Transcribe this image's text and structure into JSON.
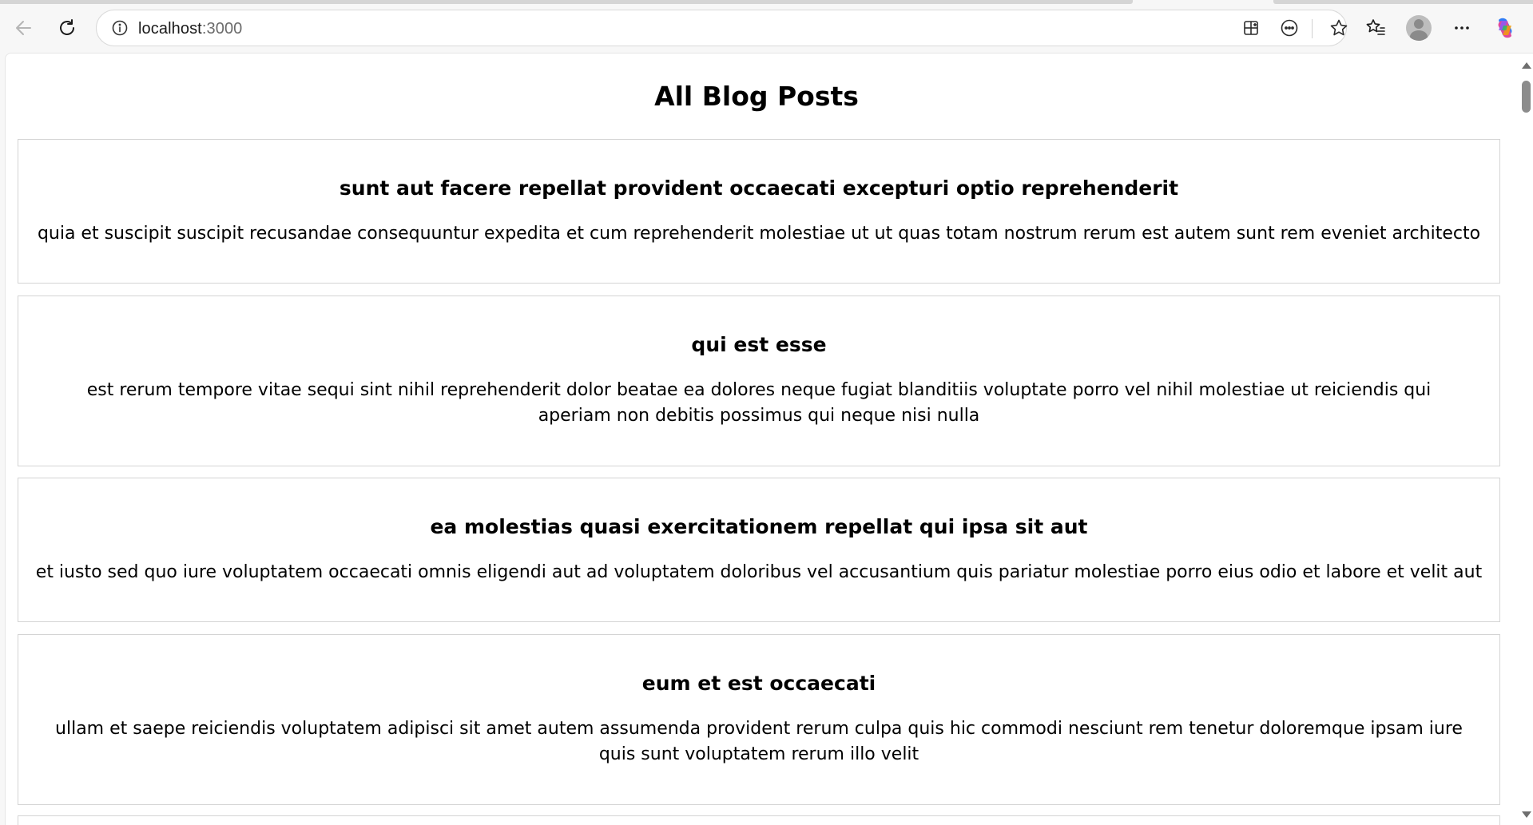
{
  "browser": {
    "url_host": "localhost",
    "url_port": ":3000",
    "icons": {
      "back": "back-arrow-icon",
      "reload": "reload-icon",
      "site_info": "info-icon",
      "app": "app-install-icon",
      "chat": "chat-bubble-icon",
      "star": "star-icon",
      "favorites": "favorites-icon",
      "profile": "profile-avatar",
      "more": "more-dots-icon",
      "copilot": "copilot-icon"
    }
  },
  "page": {
    "title": "All Blog Posts",
    "posts": [
      {
        "title": "sunt aut facere repellat provident occaecati excepturi optio reprehenderit",
        "body": "quia et suscipit suscipit recusandae consequuntur expedita et cum reprehenderit molestiae ut ut quas totam nostrum rerum est autem sunt rem eveniet architecto"
      },
      {
        "title": "qui est esse",
        "body": "est rerum tempore vitae sequi sint nihil reprehenderit dolor beatae ea dolores neque fugiat blanditiis voluptate porro vel nihil molestiae ut reiciendis qui aperiam non debitis possimus qui neque nisi nulla"
      },
      {
        "title": "ea molestias quasi exercitationem repellat qui ipsa sit aut",
        "body": "et iusto sed quo iure voluptatem occaecati omnis eligendi aut ad voluptatem doloribus vel accusantium quis pariatur molestiae porro eius odio et labore et velit aut"
      },
      {
        "title": "eum et est occaecati",
        "body": "ullam et saepe reiciendis voluptatem adipisci sit amet autem assumenda provident rerum culpa quis hic commodi nesciunt rem tenetur doloremque ipsam iure quis sunt voluptatem rerum illo velit"
      }
    ]
  },
  "colors": {
    "chrome_bg": "#f7f7f7",
    "page_bg": "#ffffff",
    "card_border": "#d4d4d4",
    "text": "#000000"
  }
}
